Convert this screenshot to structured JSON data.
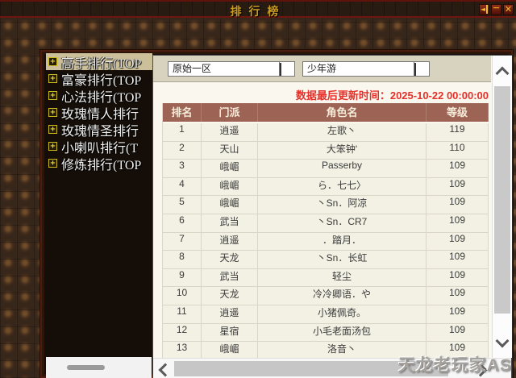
{
  "window": {
    "title": "排行榜",
    "controls": {
      "collapse": "◄",
      "minimize": "－",
      "close": "✕"
    }
  },
  "sidebar": {
    "expand_glyph": "+",
    "items": [
      {
        "label": "高手排行(TOP",
        "selected": true
      },
      {
        "label": "富豪排行(TOP",
        "selected": false
      },
      {
        "label": "心法排行(TOP",
        "selected": false
      },
      {
        "label": "玫瑰情人排行",
        "selected": false
      },
      {
        "label": "玫瑰情圣排行",
        "selected": false
      },
      {
        "label": "小喇叭排行(T",
        "selected": false
      },
      {
        "label": "修炼排行(TOP",
        "selected": false
      }
    ]
  },
  "filters": {
    "server": "原始一区",
    "category": "少年游"
  },
  "notice": "数据最后更新时间：2025-10-22 00:00:00",
  "table": {
    "columns": [
      "排名",
      "门派",
      "角色名",
      "等级"
    ],
    "rows": [
      {
        "rank": "1",
        "sect": "逍遥",
        "name": "左歌丶",
        "level": "119"
      },
      {
        "rank": "2",
        "sect": "天山",
        "name": "大笨钟'",
        "level": "110"
      },
      {
        "rank": "3",
        "sect": "峨嵋",
        "name": "Passerby",
        "level": "109"
      },
      {
        "rank": "4",
        "sect": "峨嵋",
        "name": "ら．七七〉",
        "level": "109"
      },
      {
        "rank": "5",
        "sect": "峨嵋",
        "name": "丶Sn．阿凉",
        "level": "109"
      },
      {
        "rank": "6",
        "sect": "武当",
        "name": "丶Sn．CR7",
        "level": "109"
      },
      {
        "rank": "7",
        "sect": "逍遥",
        "name": "．踏月．",
        "level": "109"
      },
      {
        "rank": "8",
        "sect": "天龙",
        "name": "丶Sn．长虹",
        "level": "109"
      },
      {
        "rank": "9",
        "sect": "武当",
        "name": "轻尘",
        "level": "109"
      },
      {
        "rank": "10",
        "sect": "天龙",
        "name": "冷冷卿语．や",
        "level": "109"
      },
      {
        "rank": "11",
        "sect": "逍遥",
        "name": "小猪佩奇。",
        "level": "109"
      },
      {
        "rank": "12",
        "sect": "星宿",
        "name": "小毛老面汤包",
        "level": "109"
      },
      {
        "rank": "13",
        "sect": "峨嵋",
        "name": "洛音丶",
        "level": "109"
      }
    ]
  },
  "watermark": "天龙老玩家AS",
  "colors": {
    "header_bg": "#9d6355",
    "accent_red": "#e5312b",
    "title_gold": "#c99b25",
    "selection_tan": "#ccc09a"
  }
}
